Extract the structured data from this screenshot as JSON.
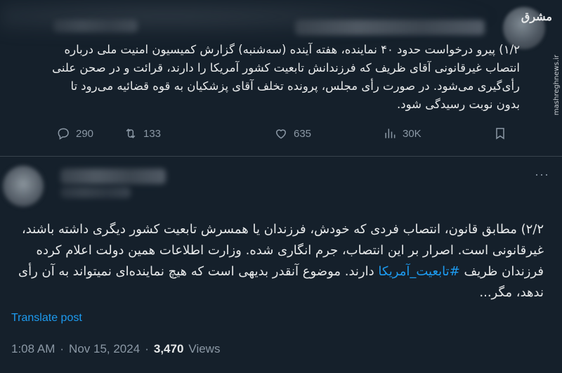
{
  "watermark": "مشرق",
  "site": "mashreghnews.ir",
  "tweet1": {
    "text": "۱/۲) پیرو درخواست حدود ۴۰ نماینده، هفته آینده (سه‌شنبه) گزارش کمیسیون امنیت ملی درباره انتصاب غیرقانونی آقای ظریف که فرزندانش تابعیت کشور آمریکا را دارند، قرائت و در صحن علنی رأی‌گیری می‌شود. در صورت رأی مجلس، پرونده تخلف آقای پزشکیان به قوه قضائیه می‌رود تا بدون نوبت رسیدگی شود.",
    "replies": "290",
    "retweets": "133",
    "likes": "635",
    "views": "30K"
  },
  "tweet2": {
    "more": "···",
    "text_before": "۲/۲) مطابق قانون، انتصاب فردی که خودش، فرزندان یا همسرش تابعیت کشور دیگری داشته باشند، غیرقانونی است. اصرار بر این انتصاب، جرم انگاری شده. وزارت اطلاعات همین دولت اعلام کرده فرزندان ظریف ",
    "hashtag": "#تابعیت_آمریکا",
    "text_after": " دارند. موضوع آنقدر بدیهی است که هیچ نماینده‌ای نمیتواند به آن رأی ندهد، مگر...",
    "translate": "Translate post",
    "time": "1:08 AM",
    "sep1": "·",
    "date": "Nov 15, 2024",
    "sep2": "·",
    "views_count": "3,470",
    "views_label": "Views"
  },
  "colors": {
    "bg": "#15202b",
    "text": "#e7e9ea",
    "muted": "#8b98a5",
    "accent": "#1d9bf0",
    "divider": "#38444d"
  }
}
